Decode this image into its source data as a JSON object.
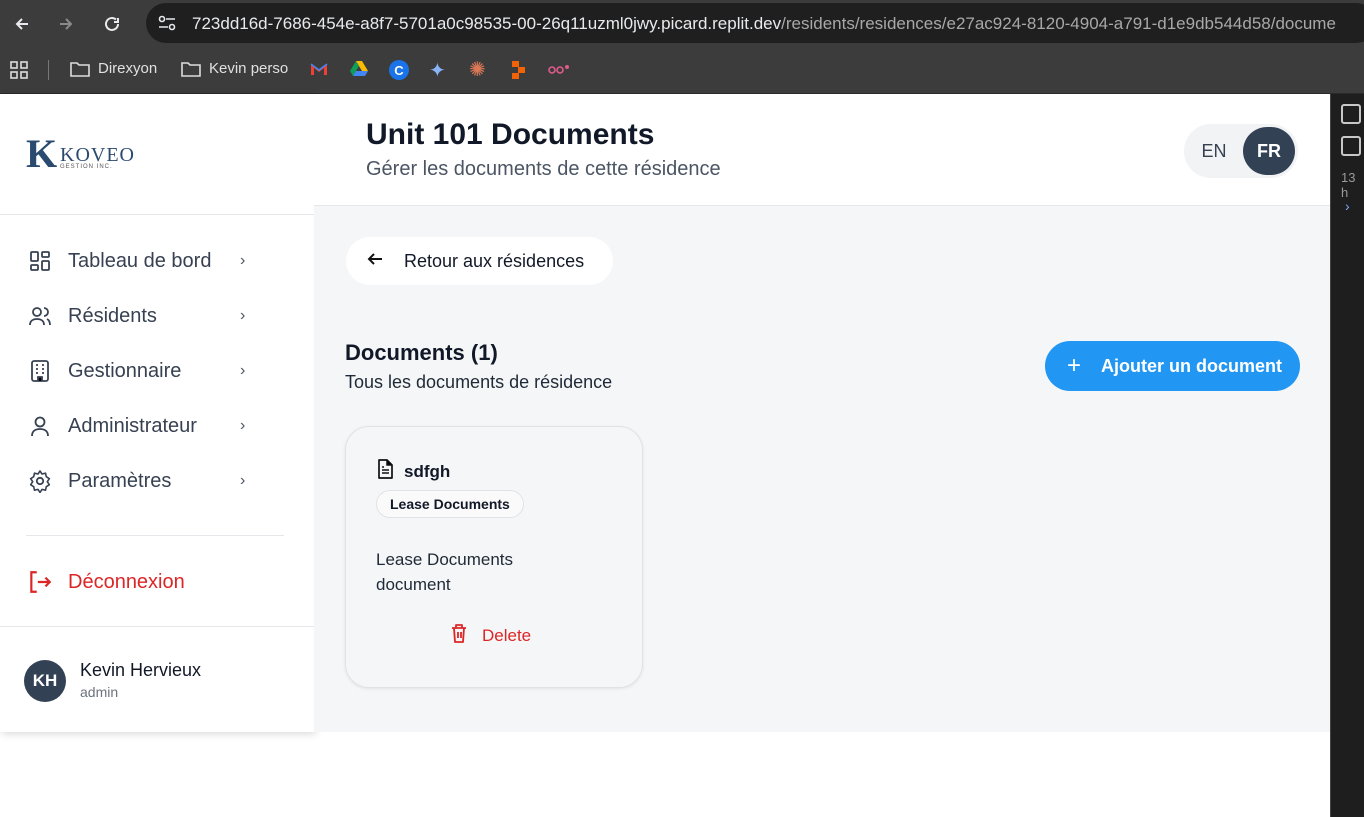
{
  "browser": {
    "url_host": "723dd16d-7686-454e-a8f7-5701a0c98535-00-26q11uzml0jwy.picard.replit.dev",
    "url_path": "/residents/residences/e27ac924-8120-4904-a791-d1e9db544d58/docume",
    "bookmarks": [
      {
        "label": "Direxyon"
      },
      {
        "label": "Kevin perso"
      }
    ]
  },
  "devtools": {
    "label": "13 h"
  },
  "brand": {
    "mark": "K",
    "name": "KOVEO",
    "tagline": "GESTION INC."
  },
  "sidebar": {
    "items": [
      {
        "label": "Tableau de bord"
      },
      {
        "label": "Résidents"
      },
      {
        "label": "Gestionnaire"
      },
      {
        "label": "Administrateur"
      },
      {
        "label": "Paramètres"
      }
    ],
    "logout": "Déconnexion"
  },
  "user": {
    "initials": "KH",
    "name": "Kevin Hervieux",
    "role": "admin"
  },
  "header": {
    "title": "Unit 101 Documents",
    "subtitle": "Gérer les documents de cette résidence",
    "lang_en": "EN",
    "lang_fr": "FR",
    "active_lang": "FR"
  },
  "main": {
    "back_label": "Retour aux résidences",
    "docs_title": "Documents (1)",
    "docs_subtitle": "Tous les documents de résidence",
    "add_label": "Ajouter un document",
    "documents": [
      {
        "name": "sdfgh",
        "type": "Lease Documents",
        "description": "Lease Documents document",
        "delete_label": "Delete"
      }
    ]
  },
  "colors": {
    "primary": "#2196f3",
    "danger": "#dc2626",
    "avatar": "#334155"
  }
}
